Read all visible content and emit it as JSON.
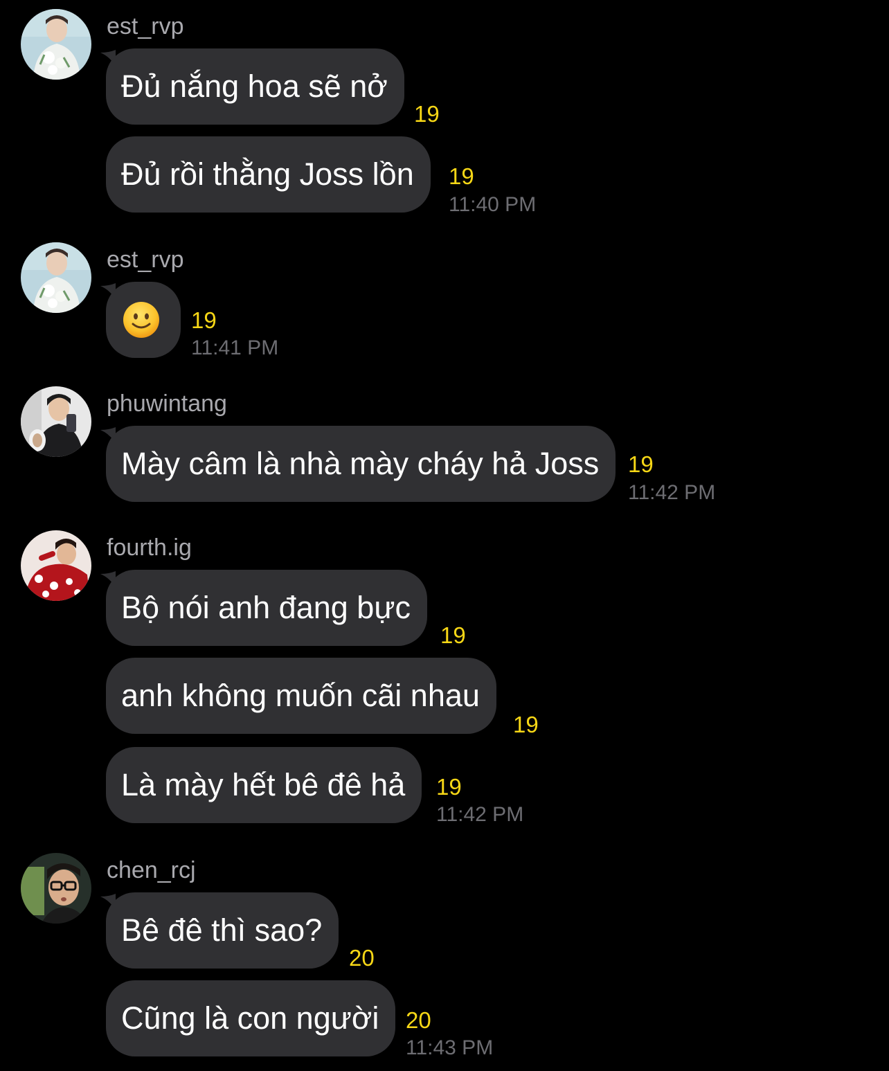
{
  "colors": {
    "background": "#000000",
    "bubble": "#303033",
    "username": "#a9a9ae",
    "count": "#f7d716",
    "timestamp": "#6d6d72"
  },
  "groups": [
    {
      "username": "est_rvp",
      "avatar": "avatar-photo",
      "messages": [
        {
          "text": "Đủ nắng hoa sẽ nở",
          "count": "19"
        },
        {
          "text": "Đủ rồi thằng Joss lồn",
          "count": "19"
        }
      ],
      "time": "11:40 PM"
    },
    {
      "username": "est_rvp",
      "avatar": "avatar-photo",
      "messages": [
        {
          "text": "🙂",
          "icon": "slightly-smiling-face-emoji",
          "count": "19"
        }
      ],
      "time": "11:41 PM"
    },
    {
      "username": "phuwintang",
      "avatar": "avatar-photo",
      "messages": [
        {
          "text": "Mày câm là nhà mày cháy hả Joss",
          "count": "19"
        }
      ],
      "time": "11:42 PM"
    },
    {
      "username": "fourth.ig",
      "avatar": "avatar-photo",
      "messages": [
        {
          "text": "Bộ nói anh đang bực",
          "count": "19"
        },
        {
          "text": "anh không muốn cãi nhau",
          "count": "19"
        },
        {
          "text": "Là mày hết bê đê hả",
          "count": "19"
        }
      ],
      "time": "11:42 PM"
    },
    {
      "username": "chen_rcj",
      "avatar": "avatar-photo",
      "messages": [
        {
          "text": "Bê đê thì sao?",
          "count": "20"
        },
        {
          "text": "Cũng là con người",
          "count": "20"
        }
      ],
      "time": "11:43 PM"
    }
  ]
}
